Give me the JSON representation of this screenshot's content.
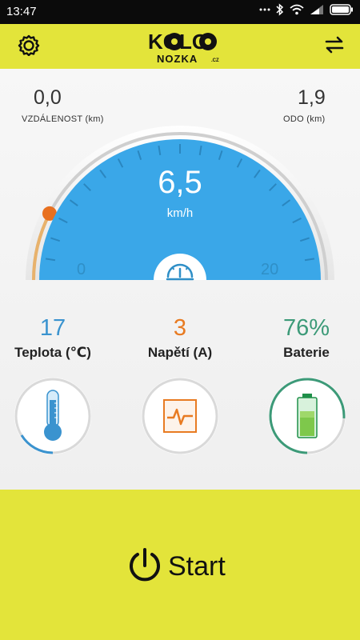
{
  "status_bar": {
    "time": "13:47"
  },
  "app": {
    "logo_text": {
      "line1": "KOLO",
      "line2": "NOZKA",
      "suffix": ".CZ"
    },
    "accent_color": "#e3e43a"
  },
  "stats": {
    "distance": {
      "value": "0,0",
      "label": "VZDÁLENOST (km)"
    },
    "odo": {
      "value": "1,9",
      "label": "ODO  (km)"
    }
  },
  "speedometer": {
    "speed": "6,5",
    "unit": "km/h",
    "scale_min": "0",
    "scale_max": "20",
    "progress_fraction": 0.15,
    "face_color": "#3aa7e8"
  },
  "metrics": [
    {
      "value": "17",
      "label": "Teplota (℃)",
      "color": "#3a93cf",
      "icon": "thermometer-icon"
    },
    {
      "value": "3",
      "label": "Napětí (A)",
      "color": "#e87b22",
      "icon": "pulse-icon"
    },
    {
      "value": "76%",
      "label": "Baterie",
      "color": "#3c9a78",
      "icon": "battery-icon"
    }
  ],
  "start_button": {
    "label": "Start"
  }
}
